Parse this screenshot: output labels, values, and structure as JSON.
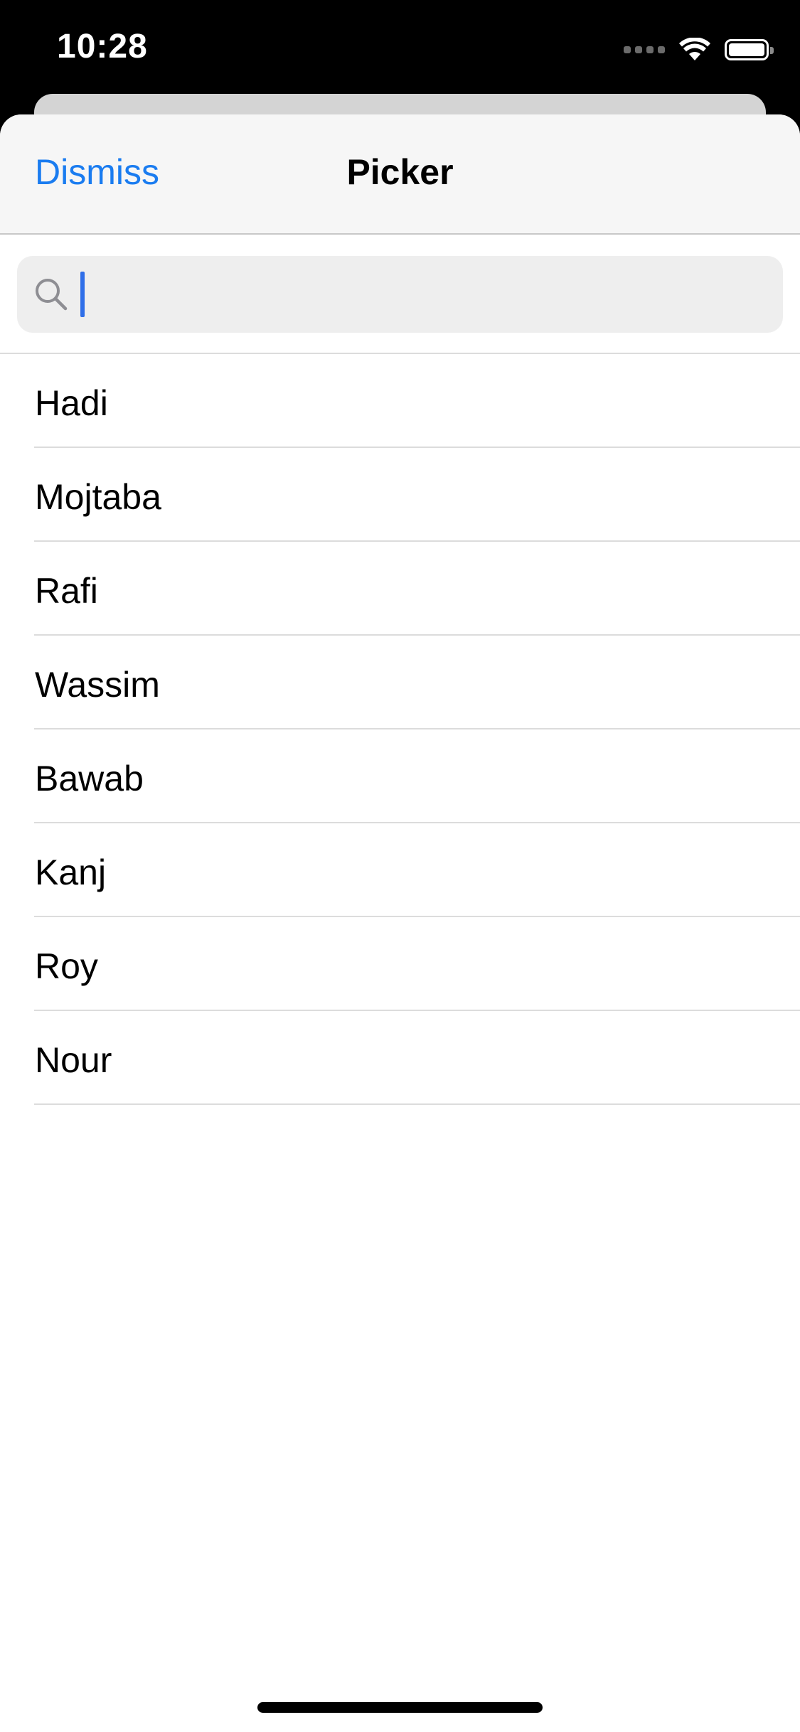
{
  "status_bar": {
    "time": "10:28",
    "icons": [
      "signal-icon",
      "wifi-icon",
      "battery-icon"
    ]
  },
  "nav": {
    "dismiss_label": "Dismiss",
    "title": "Picker"
  },
  "search": {
    "value": "",
    "placeholder": "",
    "icon": "search-icon"
  },
  "items": [
    {
      "label": "Hadi"
    },
    {
      "label": "Mojtaba"
    },
    {
      "label": "Rafi"
    },
    {
      "label": "Wassim"
    },
    {
      "label": "Bawab"
    },
    {
      "label": "Kanj"
    },
    {
      "label": "Roy"
    },
    {
      "label": "Nour"
    }
  ],
  "colors": {
    "accent": "#1a7cf0",
    "caret": "#2f6ee8",
    "nav_background": "#f6f6f6",
    "search_background": "#eeeeee"
  }
}
